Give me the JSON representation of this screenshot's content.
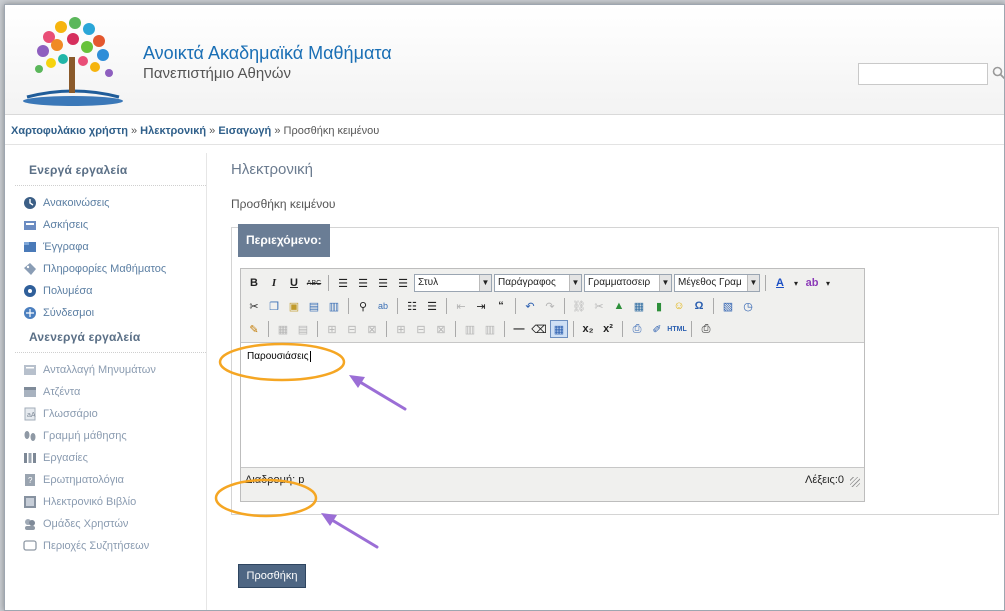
{
  "header": {
    "title": "Ανοικτά Ακαδημαϊκά Μαθήματα",
    "subtitle": "Πανεπιστήμιο Αθηνών",
    "search_placeholder": ""
  },
  "breadcrumb": {
    "items": [
      "Χαρτοφυλάκιο χρήστη",
      "Ηλεκτρονική",
      "Εισαγωγή"
    ],
    "current": "Προσθήκη κειμένου",
    "separator": "»"
  },
  "sidebar": {
    "active_heading": "Ενεργά εργαλεία",
    "active_items": [
      {
        "label": "Ανακοινώσεις",
        "icon": "announcements-icon"
      },
      {
        "label": "Ασκήσεις",
        "icon": "exercises-icon"
      },
      {
        "label": "Έγγραφα",
        "icon": "documents-icon"
      },
      {
        "label": "Πληροφορίες Μαθήματος",
        "icon": "course-info-icon"
      },
      {
        "label": "Πολυμέσα",
        "icon": "multimedia-icon"
      },
      {
        "label": "Σύνδεσμοι",
        "icon": "links-icon"
      }
    ],
    "inactive_heading": "Ανενεργά εργαλεία",
    "inactive_items": [
      {
        "label": "Ανταλλαγή Μηνυμάτων",
        "icon": "messages-icon"
      },
      {
        "label": "Ατζέντα",
        "icon": "agenda-icon"
      },
      {
        "label": "Γλωσσάριο",
        "icon": "glossary-icon"
      },
      {
        "label": "Γραμμή μάθησης",
        "icon": "learning-path-icon"
      },
      {
        "label": "Εργασίες",
        "icon": "assignments-icon"
      },
      {
        "label": "Ερωτηματολόγια",
        "icon": "questionnaire-icon"
      },
      {
        "label": "Ηλεκτρονικό Βιβλίο",
        "icon": "ebook-icon"
      },
      {
        "label": "Ομάδες Χρηστών",
        "icon": "user-groups-icon"
      },
      {
        "label": "Περιοχές Συζητήσεων",
        "icon": "forum-icon"
      }
    ]
  },
  "main": {
    "title": "Ηλεκτρονική",
    "subtitle": "Προσθήκη κειμένου",
    "legend": "Περιεχόμενο:",
    "editor": {
      "style_select": "Στυλ",
      "format_select": "Παράγραφος",
      "font_select": "Γραμματοσειρ",
      "size_select": "Μέγεθος Γραμ",
      "content": "Παρουσιάσεις",
      "path_label": "Διαδρομή: p",
      "word_count": "Λέξεις:0"
    },
    "submit_label": "Προσθήκη"
  },
  "colors": {
    "brand_blue": "#1a6fb5",
    "legend_bg": "#6a7d95",
    "button_bg": "#4e6683",
    "annotation_orange": "#f5a623",
    "annotation_purple": "#9b6ed6"
  }
}
